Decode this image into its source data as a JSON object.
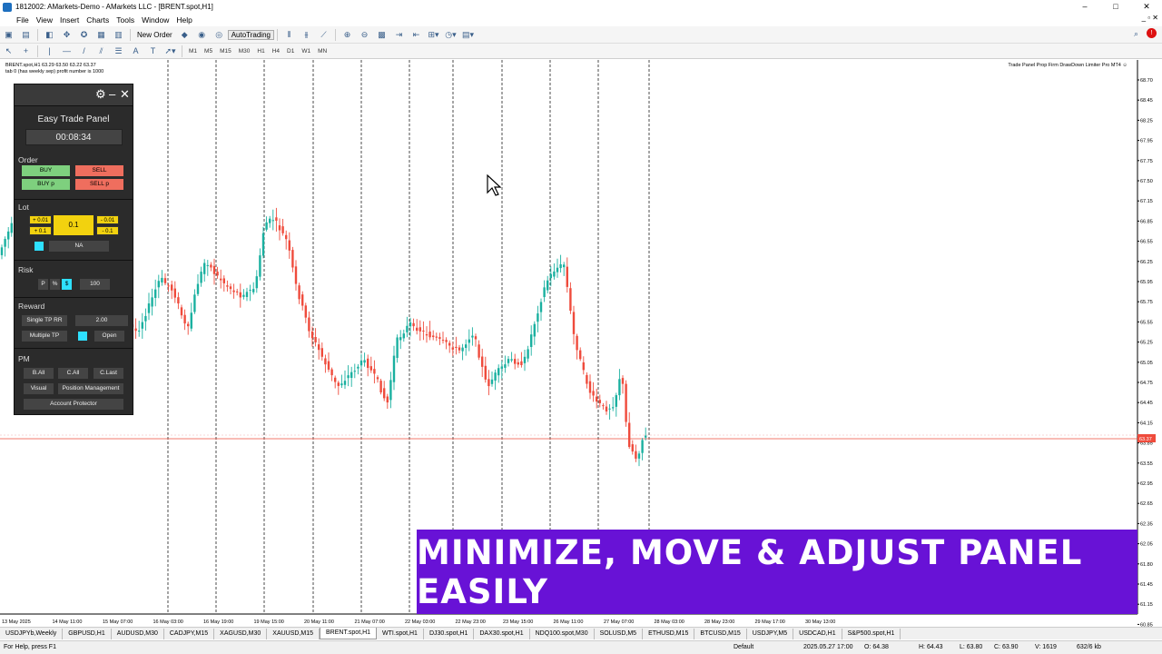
{
  "window": {
    "title": "1812002: AMarkets-Demo - AMarkets LLC - [BRENT.spot,H1]",
    "controls": [
      "–",
      "□",
      "✕"
    ]
  },
  "menu": {
    "items": [
      "File",
      "View",
      "Insert",
      "Charts",
      "Tools",
      "Window",
      "Help"
    ],
    "right": "_ ▫ ✕"
  },
  "toolbar": {
    "new_order": "New Order",
    "auto_trading": "AutoTrading"
  },
  "timeframes": [
    "M1",
    "M5",
    "M15",
    "M30",
    "H1",
    "H4",
    "D1",
    "W1",
    "MN"
  ],
  "chart": {
    "symbol_line1": "BRENT.spot,H1  63.29 63.50 63.22 63.37",
    "symbol_line2": "tab 0 (has weekly sep) profit number is 1000",
    "ea_label": "Trade Panel Prop Firm DrawDown Limiter Pro MT4 ☺",
    "price_labels": [
      "68.70",
      "68.45",
      "68.25",
      "67.95",
      "67.75",
      "67.50",
      "67.15",
      "66.85",
      "66.55",
      "66.25",
      "65.95",
      "65.75",
      "65.55",
      "65.25",
      "65.05",
      "64.75",
      "64.45",
      "64.15",
      "63.85",
      "63.55",
      "63.37",
      "62.95",
      "62.65",
      "62.35",
      "62.05",
      "61.80",
      "61.45",
      "61.15",
      "60.85"
    ],
    "current_price": "63.37",
    "time_labels": [
      "13 May 2025",
      "14 May 11:00",
      "15 May 07:00",
      "16 May 03:00",
      "16 May 19:00",
      "19 May 15:00",
      "20 May 11:00",
      "21 May 07:00",
      "22 May 03:00",
      "22 May 23:00",
      "23 May 15:00",
      "26 May 11:00",
      "27 May 07:00",
      "28 May 03:00",
      "28 May 23:00",
      "29 May 17:00",
      "30 May 13:00"
    ]
  },
  "panel": {
    "title": "Easy Trade Panel",
    "timer": "00:08:34",
    "header_icons": [
      "⚙",
      "–",
      "✕"
    ],
    "order": {
      "label": "Order",
      "buy": "BUY",
      "sell": "SELL",
      "buy_p": "BUY p",
      "sell_p": "SELL p"
    },
    "lot": {
      "label": "Lot",
      "plus_001": "+ 0.01",
      "plus_01": "+ 0.1",
      "value": "0.1",
      "minus_001": "- 0.01",
      "minus_01": "- 0.1",
      "na": "NA"
    },
    "risk": {
      "label": "Risk",
      "p": "P",
      "pct": "%",
      "usd": "$",
      "value": "100"
    },
    "reward": {
      "label": "Reward",
      "single_tp": "Single TP RR",
      "single_val": "2.00",
      "multiple_tp": "Multiple TP",
      "open": "Open"
    },
    "pm": {
      "label": "PM",
      "b_all": "B.All",
      "c_all": "C.All",
      "c_last": "C.Last",
      "visual": "Visual",
      "position_mgmt": "Position Management",
      "account_protector": "Account Protector"
    }
  },
  "tabs": [
    "USDJPYb,Weekly",
    "GBPUSD,H1",
    "AUDUSD,M30",
    "CADJPY,M15",
    "XAGUSD,M30",
    "XAUUSD,M15",
    "BRENT.spot,H1",
    "WTI.spot,H1",
    "DJ30.spot,H1",
    "DAX30.spot,H1",
    "NDQ100.spot,M30",
    "SOLUSD,M5",
    "ETHUSD,M15",
    "BTCUSD,M15",
    "USDJPY,M5",
    "USDCAD,H1",
    "S&P500.spot,H1"
  ],
  "active_tab": "BRENT.spot,H1",
  "status": {
    "help": "For Help, press F1",
    "profile": "Default",
    "datetime": "2025.05.27 17:00",
    "open": "O: 64.38",
    "high": "H: 64.43",
    "low": "L: 63.80",
    "close": "C: 63.90",
    "volume": "V: 1619",
    "traffic": "632/6 kb"
  },
  "banner": "MINIMIZE, MOVE & ADJUST PANEL EASILY",
  "colors": {
    "bull": "#1ab0a0",
    "bear": "#ef4b3c",
    "banner": "#6812d6",
    "panel_bg": "#2b2b2b"
  }
}
